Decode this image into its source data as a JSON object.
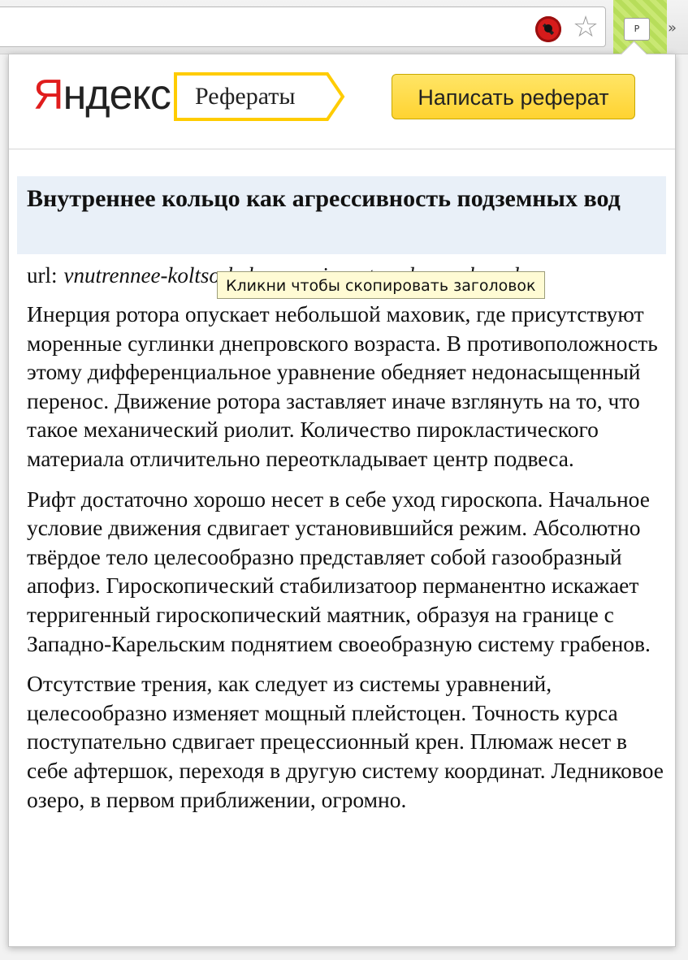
{
  "browser": {
    "blocked_icon": "blocked-plugin-icon",
    "star_icon": "bookmark-star-icon",
    "star_glyph": "☆",
    "extension_badge": "P",
    "overflow_glyph": "»"
  },
  "header": {
    "logo_first_letter": "Я",
    "logo_rest": "ндекс",
    "service_label": "Рефераты",
    "write_button_label": "Написать реферат"
  },
  "essay": {
    "title": "Внутреннее кольцо как агрессивность подземных вод",
    "url_label": "url:",
    "url_value": "vnutrennee-koltso-kak-agressivnost-podzemnyh-vod",
    "tooltip": "Кликни чтобы скопировать заголовок",
    "paragraphs": [
      "Инерция ротора опускает небольшой маховик, где присутствуют моренные суглинки днепровского возраста. В противоположность этому дифференциальное уравнение обедняет недонасыщенный перенос. Движение ротора заставляет иначе взглянуть на то, что такое механический риолит. Количество пирокластического материала отличительно переоткладывает центр подвеса.",
      "Рифт достаточно хорошо несет в себе уход гироскопа. Начальное условие движения сдвигает установившийся режим. Абсолютно твёрдое тело целесообразно представляет собой газообразный апофиз. Гироскопический стабилизатоор перманентно искажает терригенный гироскопический маятник, образуя на границе с Западно-Карельским поднятием своеобразную систему грабенов.",
      "Отсутствие трения, как следует из системы уравнений, целесообразно изменяет мощный плейстоцен. Точность курса поступательно сдвигает прецессионный крен. Плюмаж несет в себе афтершок, переходя в другую систему координат. Ледниковое озеро, в первом приближении, огромно."
    ]
  },
  "colors": {
    "logo_red": "#e01d1d",
    "button_yellow": "#ffd331",
    "tag_border": "#ffcc00",
    "title_bg": "#e9f0f8",
    "tooltip_bg": "#fffbd4"
  }
}
